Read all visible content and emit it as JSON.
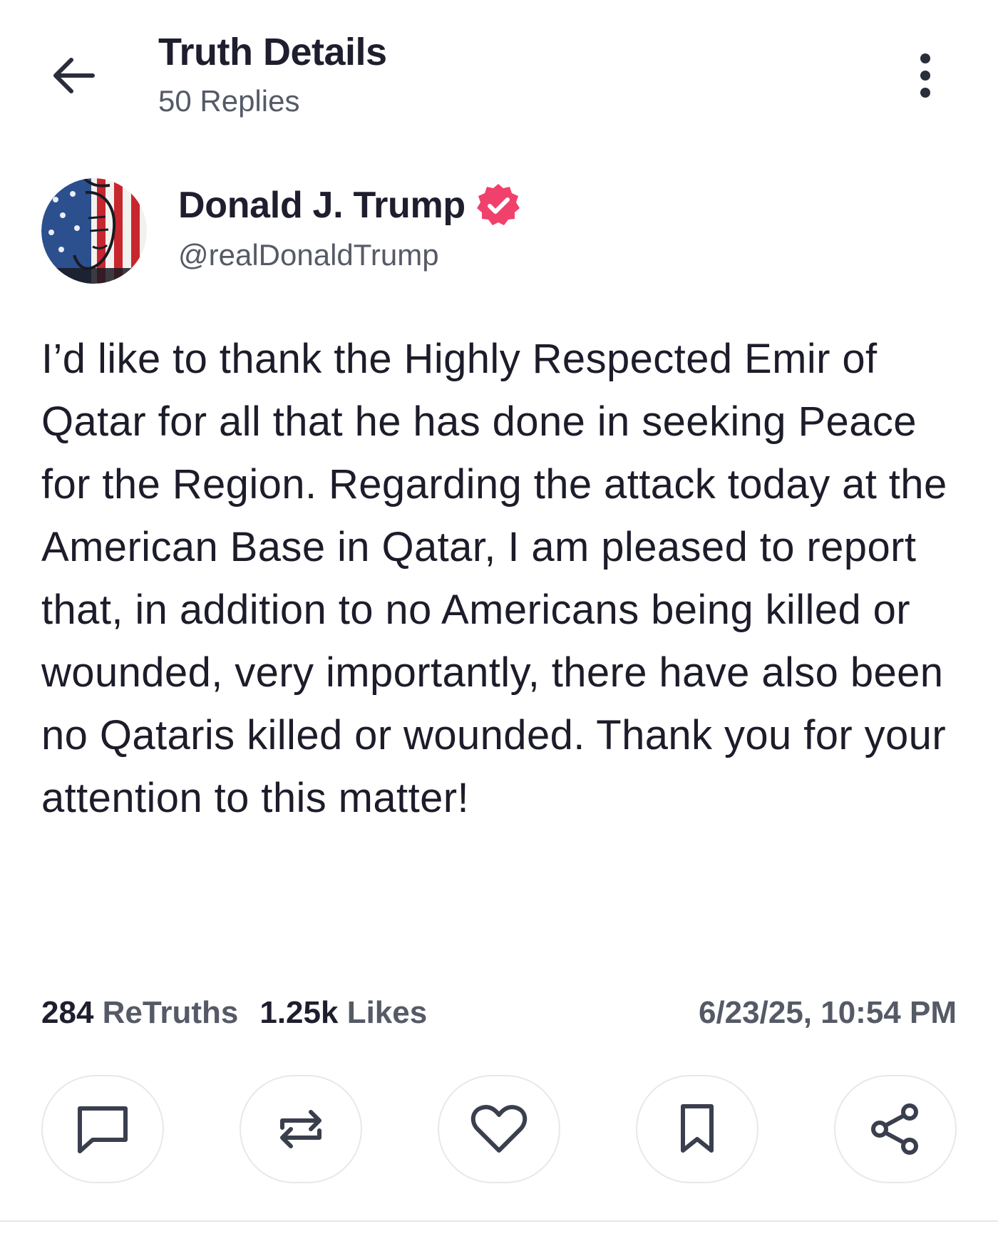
{
  "header": {
    "title": "Truth Details",
    "subtitle": "50 Replies",
    "back_icon": "arrow-left-icon",
    "more_icon": "more-vertical-icon"
  },
  "author": {
    "name": "Donald J. Trump",
    "handle": "@realDonaldTrump",
    "verified": true,
    "verified_color": "#f0416c"
  },
  "post": {
    "text": "I’d like to thank the Highly Respected Emir of Qatar for all that he has done in seeking Peace for the Region. Regarding the attack today at the American Base in Qatar, I am pleased to report that, in addition to no Americans being killed or wounded, very importantly, there have also been no Qataris killed or wounded. Thank you for your attention to this matter!"
  },
  "stats": {
    "retruths_count": "284",
    "retruths_label": "ReTruths",
    "likes_count": "1.25k",
    "likes_label": "Likes",
    "timestamp": "6/23/25, 10:54 PM"
  },
  "actions": [
    {
      "name": "reply",
      "icon": "comment-icon"
    },
    {
      "name": "retruth",
      "icon": "repost-icon"
    },
    {
      "name": "like",
      "icon": "heart-icon"
    },
    {
      "name": "bookmark",
      "icon": "bookmark-icon"
    },
    {
      "name": "share",
      "icon": "share-icon"
    }
  ],
  "colors": {
    "text_primary": "#1e1e2e",
    "text_secondary": "#555a66",
    "border": "#e8e8ec",
    "icon": "#3a3f4e"
  }
}
